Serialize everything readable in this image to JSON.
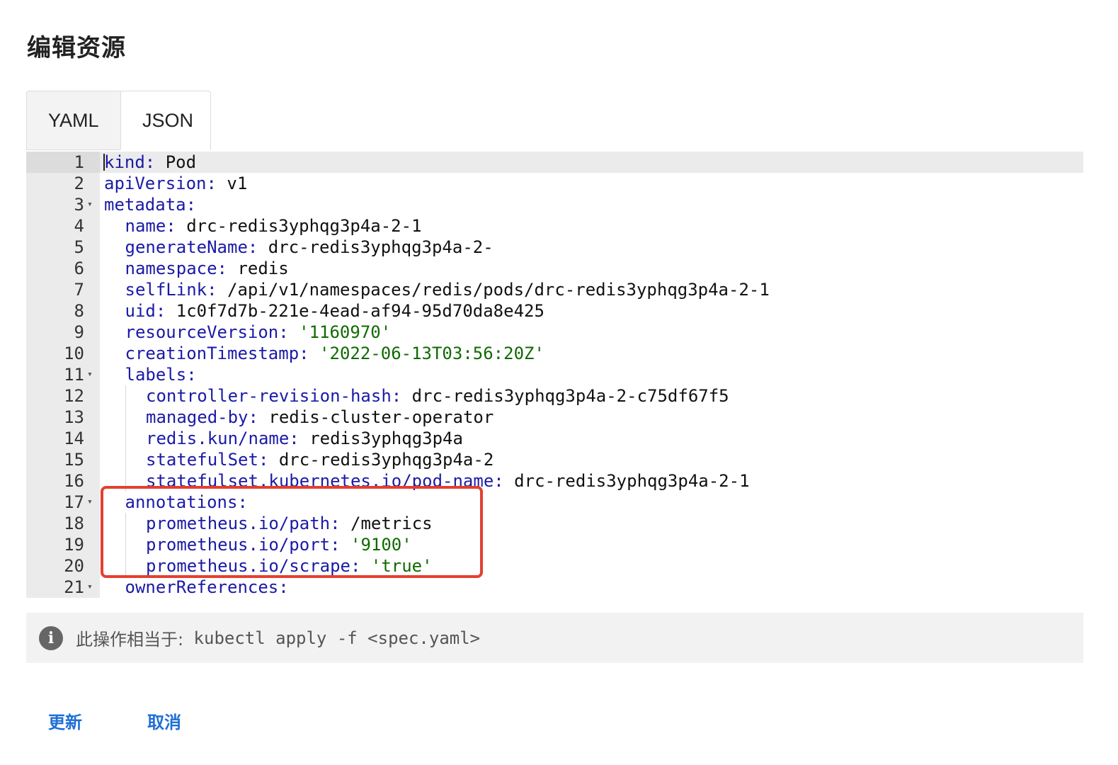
{
  "page": {
    "title": "编辑资源"
  },
  "tabs": [
    {
      "label": "YAML",
      "active": false
    },
    {
      "label": "JSON",
      "active": true
    }
  ],
  "editor": {
    "lines": [
      {
        "n": "1",
        "indent": 0,
        "fold": false,
        "key": "kind:",
        "value": " Pod",
        "vtype": "plain"
      },
      {
        "n": "2",
        "indent": 0,
        "fold": false,
        "key": "apiVersion:",
        "value": " v1",
        "vtype": "plain"
      },
      {
        "n": "3",
        "indent": 0,
        "fold": true,
        "key": "metadata:",
        "value": "",
        "vtype": "plain"
      },
      {
        "n": "4",
        "indent": 1,
        "fold": false,
        "key": "name:",
        "value": " drc-redis3yphqg3p4a-2-1",
        "vtype": "plain"
      },
      {
        "n": "5",
        "indent": 1,
        "fold": false,
        "key": "generateName:",
        "value": " drc-redis3yphqg3p4a-2-",
        "vtype": "plain"
      },
      {
        "n": "6",
        "indent": 1,
        "fold": false,
        "key": "namespace:",
        "value": " redis",
        "vtype": "plain"
      },
      {
        "n": "7",
        "indent": 1,
        "fold": false,
        "key": "selfLink:",
        "value": " /api/v1/namespaces/redis/pods/drc-redis3yphqg3p4a-2-1",
        "vtype": "plain"
      },
      {
        "n": "8",
        "indent": 1,
        "fold": false,
        "key": "uid:",
        "value": " 1c0f7d7b-221e-4ead-af94-95d70da8e425",
        "vtype": "plain"
      },
      {
        "n": "9",
        "indent": 1,
        "fold": false,
        "key": "resourceVersion:",
        "value": " '1160970'",
        "vtype": "str"
      },
      {
        "n": "10",
        "indent": 1,
        "fold": false,
        "key": "creationTimestamp:",
        "value": " '2022-06-13T03:56:20Z'",
        "vtype": "str"
      },
      {
        "n": "11",
        "indent": 1,
        "fold": true,
        "key": "labels:",
        "value": "",
        "vtype": "plain"
      },
      {
        "n": "12",
        "indent": 2,
        "fold": false,
        "key": "controller-revision-hash:",
        "value": " drc-redis3yphqg3p4a-2-c75df67f5",
        "vtype": "plain"
      },
      {
        "n": "13",
        "indent": 2,
        "fold": false,
        "key": "managed-by:",
        "value": " redis-cluster-operator",
        "vtype": "plain"
      },
      {
        "n": "14",
        "indent": 2,
        "fold": false,
        "key": "redis.kun/name:",
        "value": " redis3yphqg3p4a",
        "vtype": "plain"
      },
      {
        "n": "15",
        "indent": 2,
        "fold": false,
        "key": "statefulSet:",
        "value": " drc-redis3yphqg3p4a-2",
        "vtype": "plain"
      },
      {
        "n": "16",
        "indent": 2,
        "fold": false,
        "key": "statefulset.kubernetes.io/pod-name:",
        "value": " drc-redis3yphqg3p4a-2-1",
        "vtype": "plain"
      },
      {
        "n": "17",
        "indent": 1,
        "fold": true,
        "key": "annotations:",
        "value": "",
        "vtype": "plain"
      },
      {
        "n": "18",
        "indent": 2,
        "fold": false,
        "key": "prometheus.io/path:",
        "value": " /metrics",
        "vtype": "plain"
      },
      {
        "n": "19",
        "indent": 2,
        "fold": false,
        "key": "prometheus.io/port:",
        "value": " '9100'",
        "vtype": "str"
      },
      {
        "n": "20",
        "indent": 2,
        "fold": false,
        "key": "prometheus.io/scrape:",
        "value": " 'true'",
        "vtype": "str"
      },
      {
        "n": "21",
        "indent": 1,
        "fold": true,
        "key": "ownerReferences:",
        "value": "",
        "vtype": "plain"
      }
    ]
  },
  "info": {
    "icon": "info-icon",
    "icon_glyph": "i",
    "label": "此操作相当于:",
    "command": " kubectl apply -f <spec.yaml>"
  },
  "actions": {
    "update_label": "更新",
    "cancel_label": "取消"
  },
  "colors": {
    "key": "#1a1aa6",
    "string": "#106a00",
    "highlight_border": "#e4402f",
    "link": "#1f6fd6"
  }
}
